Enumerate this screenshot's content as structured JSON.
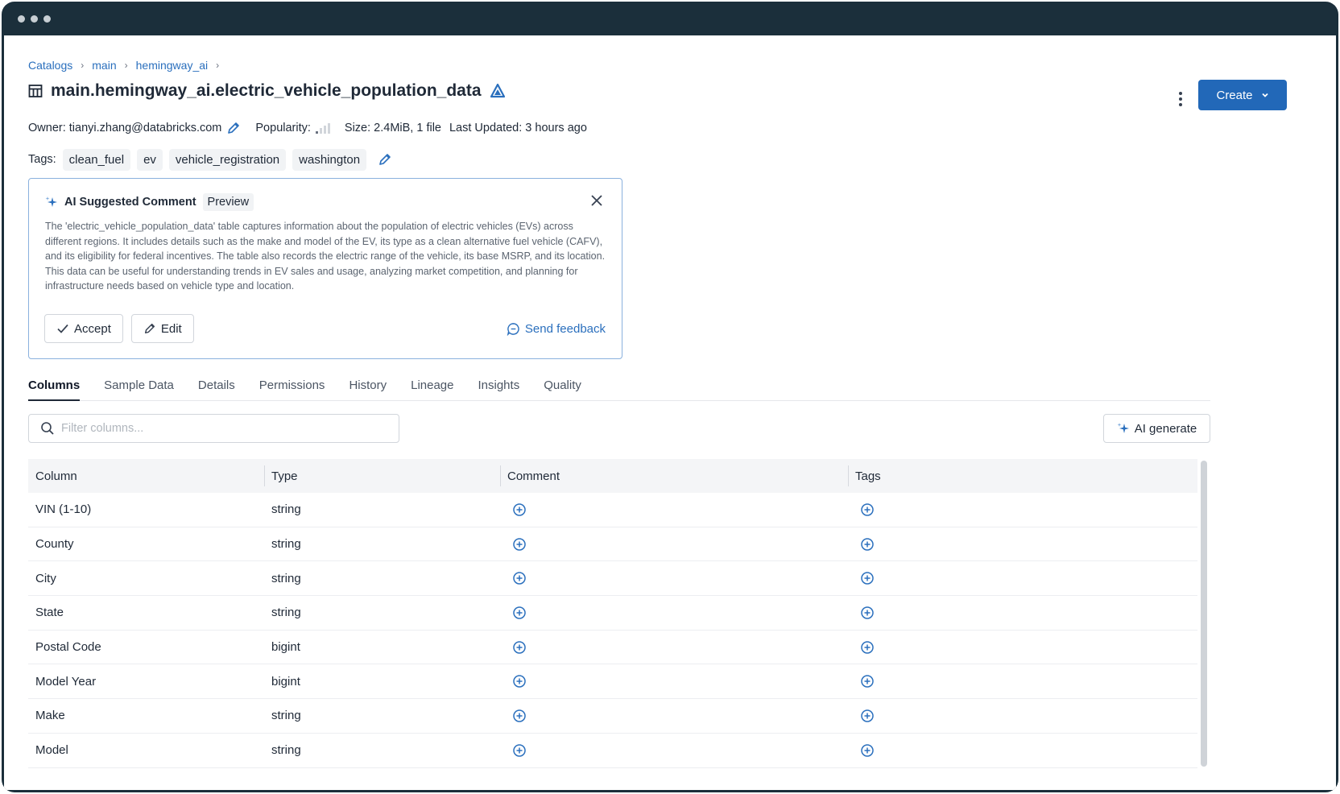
{
  "breadcrumb": [
    "Catalogs",
    "main",
    "hemingway_ai"
  ],
  "table_name": "main.hemingway_ai.electric_vehicle_population_data",
  "create_label": "Create",
  "meta": {
    "owner": "Owner: tianyi.zhang@databricks.com",
    "popularity_label": "Popularity:",
    "size": "Size: 2.4MiB, 1 file",
    "last_updated": "Last Updated: 3 hours ago"
  },
  "tags_label": "Tags:",
  "tags": [
    "clean_fuel",
    "ev",
    "vehicle_registration",
    "washington"
  ],
  "ai_comment": {
    "title": "AI Suggested Comment",
    "badge": "Preview",
    "text": "The 'electric_vehicle_population_data' table captures information about the population of electric vehicles (EVs) across different regions. It includes details such as the make and model of the EV, its type as a clean alternative fuel vehicle (CAFV), and its eligibility for federal incentives. The table also records the electric range of the vehicle, its base MSRP, and its location. This data can be useful for understanding trends in EV sales and usage, analyzing market competition, and planning for infrastructure needs based on vehicle type and location.",
    "accept_label": "Accept",
    "edit_label": "Edit",
    "feedback_label": "Send feedback"
  },
  "tabs": [
    "Columns",
    "Sample Data",
    "Details",
    "Permissions",
    "History",
    "Lineage",
    "Insights",
    "Quality"
  ],
  "filter_placeholder": "Filter columns...",
  "ai_generate_label": "AI generate",
  "columns_header": [
    "Column",
    "Type",
    "Comment",
    "Tags"
  ],
  "rows": [
    {
      "name": "VIN (1-10)",
      "type": "string"
    },
    {
      "name": "County",
      "type": "string"
    },
    {
      "name": "City",
      "type": "string"
    },
    {
      "name": "State",
      "type": "string"
    },
    {
      "name": "Postal Code",
      "type": "bigint"
    },
    {
      "name": "Model Year",
      "type": "bigint"
    },
    {
      "name": "Make",
      "type": "string"
    },
    {
      "name": "Model",
      "type": "string"
    }
  ],
  "colors": {
    "accent": "#2268b8",
    "link": "#2a6fbd",
    "titlebar": "#1b2f3b"
  }
}
